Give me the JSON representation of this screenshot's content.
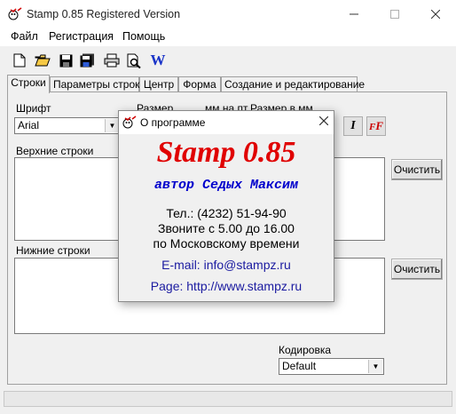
{
  "window": {
    "title": "Stamp 0.85 Registered Version"
  },
  "menu": [
    "Файл",
    "Регистрация",
    "Помощь"
  ],
  "toolbar": {
    "icons": [
      "new-file-icon",
      "open-folder-icon",
      "save-icon",
      "save-all-icon",
      "print-icon",
      "print-preview-icon",
      "word-icon"
    ],
    "word_label": "W"
  },
  "tabs": [
    "Строки",
    "Параметры строк",
    "Центр",
    "Форма",
    "Создание и редактирование"
  ],
  "panel": {
    "font_label": "Шрифт",
    "font_value": "Arial",
    "size_label": "Размер",
    "size_pt_label": "мм на пт",
    "size_mm_label": "Размер в мм",
    "upper_label": "Верхние строки",
    "lower_label": "Нижние строки",
    "clear_label": "Очистить",
    "encoding_label": "Кодировка",
    "encoding_value": "Default",
    "italic_button": "I",
    "ff_button": "F"
  },
  "dialog": {
    "title": "О программе",
    "app_name": "Stamp 0.85",
    "author": "автор Седых Максим",
    "phone": "Тел.: (4232) 51-94-90",
    "hours": "Звоните с 5.00 до 16.00",
    "timezone": "по Московскому времени",
    "email": "E-mail: info@stampz.ru",
    "page": "Page: http://www.stampz.ru"
  },
  "colors": {
    "title_red": "#e00000",
    "author_blue": "#0000cc",
    "link_blue": "#1a1aa0"
  }
}
